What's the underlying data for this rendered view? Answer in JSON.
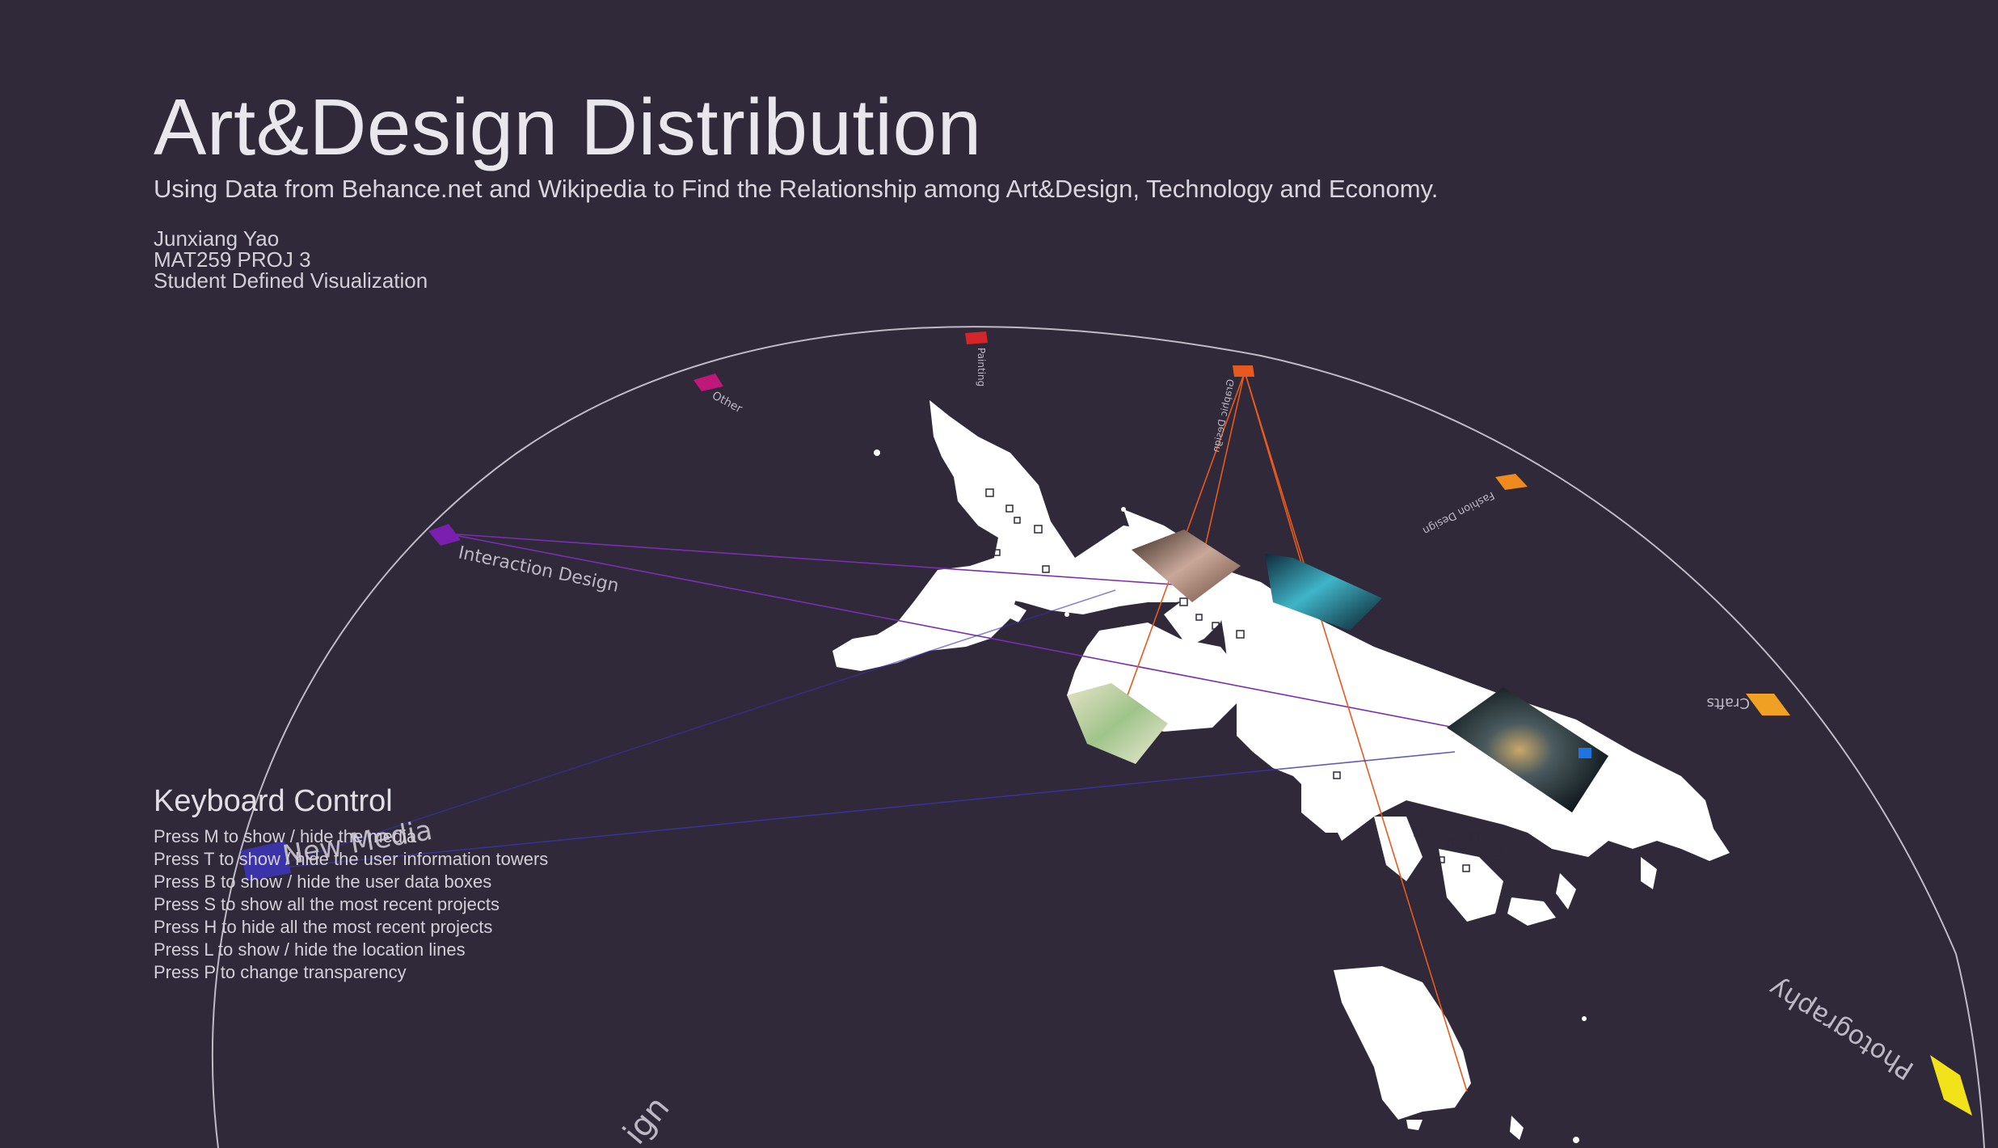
{
  "header": {
    "title": "Art&Design Distribution",
    "subtitle": "Using Data from Behance.net and Wikipedia to Find the Relationship among Art&Design, Technology and Economy.",
    "author": "Junxiang Yao",
    "course": "MAT259 PROJ 3",
    "project_type": "Student Defined Visualization"
  },
  "keyboard_control": {
    "title": "Keyboard Control",
    "lines": [
      "Press M to show / hide the media",
      "Press T to show / hide the user information towers",
      "Press B to show / hide the user data boxes",
      "Press S to show all the most recent projects",
      "Press H to hide all the most recent projects",
      "Press L to show / hide the location lines",
      "Press P to change transparency"
    ]
  },
  "categories": [
    {
      "label": "Interaction Design",
      "color": "#7a1fb0"
    },
    {
      "label": "New Media",
      "color": "#3b34a8"
    },
    {
      "label": "Other",
      "color": "#c0187a"
    },
    {
      "label": "Painting",
      "color": "#d42626"
    },
    {
      "label": "Graphic Design",
      "color": "#e65a1f"
    },
    {
      "label": "Fashion Design",
      "color": "#ee8a1e"
    },
    {
      "label": "Crafts",
      "color": "#f0a022"
    },
    {
      "label": "Photography",
      "color": "#f2e21a"
    },
    {
      "label": "ign",
      "color": "#5a5466"
    }
  ],
  "colors": {
    "background": "#2f2939",
    "land": "#ffffff",
    "ring": "#bfbac6",
    "project_badge": "#1e74e0"
  }
}
